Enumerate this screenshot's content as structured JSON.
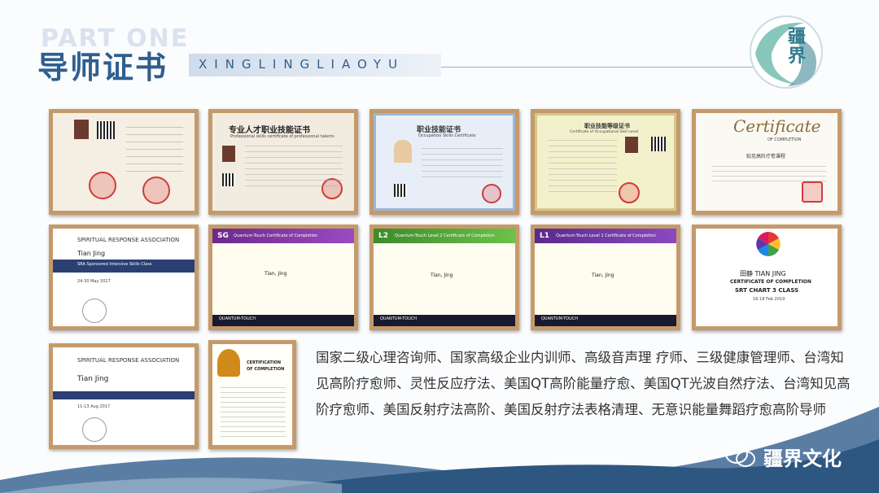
{
  "header": {
    "watermark": "PART ONE",
    "title": "导师证书",
    "subtitle": "XINGLINGLIAOYU",
    "logo_text": "疆界"
  },
  "certificates": [
    {
      "id": 1,
      "title": "",
      "lines": []
    },
    {
      "id": 2,
      "title": "专业人才职业技能证书",
      "subtitle": "Professional skills certificate of professional talents"
    },
    {
      "id": 3,
      "title": "职业技能证书",
      "subtitle": "Occupation Skills Certificate"
    },
    {
      "id": 4,
      "title": "职业技能等级证书",
      "subtitle": "Certificate of Occupational Skill Level"
    },
    {
      "id": 5,
      "title": "Certificate",
      "subtitle": "OF COMPLETION",
      "line": "知见高阶疗愈课程"
    },
    {
      "id": 6,
      "title": "SPIRITUAL RESPONSE ASSOCIATION",
      "name": "Tian Jing",
      "class": "SRA Sponsored Intensive Skills Class",
      "date": "24-30 May 2017"
    },
    {
      "id": 7,
      "badge": "SG",
      "title": "Quantum-Touch Certificate of Completion",
      "name": "Tian, Jing",
      "footer": "QUANTUM-TOUCH"
    },
    {
      "id": 8,
      "badge": "L2",
      "title": "Quantum-Touch Level 2 Certificate of Completion",
      "name": "Tian, Jing",
      "footer": "QUANTUM-TOUCH"
    },
    {
      "id": 9,
      "badge": "L1",
      "title": "Quantum-Touch Level 1 Certificate of Completion",
      "name": "Tian, Jing",
      "footer": "QUANTUM-TOUCH"
    },
    {
      "id": 10,
      "name": "田静  TIAN JING",
      "title": "CERTIFICATE OF COMPLETION",
      "class": "SRT CHART 3 CLASS",
      "date": "16-18 Feb 2019"
    },
    {
      "id": 11,
      "title": "SPIRITUAL RESPONSE ASSOCIATION",
      "name": "Tian Jing",
      "date": "11-13 Aug 2017"
    },
    {
      "id": 12,
      "title": "CERTIFICATION",
      "subtitle": "OF COMPLETION"
    }
  ],
  "body_text": "国家二级心理咨询师、国家高级企业内训师、高级音声理 疗师、三级健康管理师、台湾知见高阶疗愈师、灵性反应疗法、美国QT高阶能量疗愈、美国QT光波自然疗法、台湾知见高阶疗愈师、美国反射疗法高阶、美国反射疗法表格清理、无意识能量舞蹈疗愈高阶导师",
  "wechat_label": "疆界文化",
  "colors": {
    "accent": "#2e5f8e",
    "frame": "#c59a6a"
  }
}
